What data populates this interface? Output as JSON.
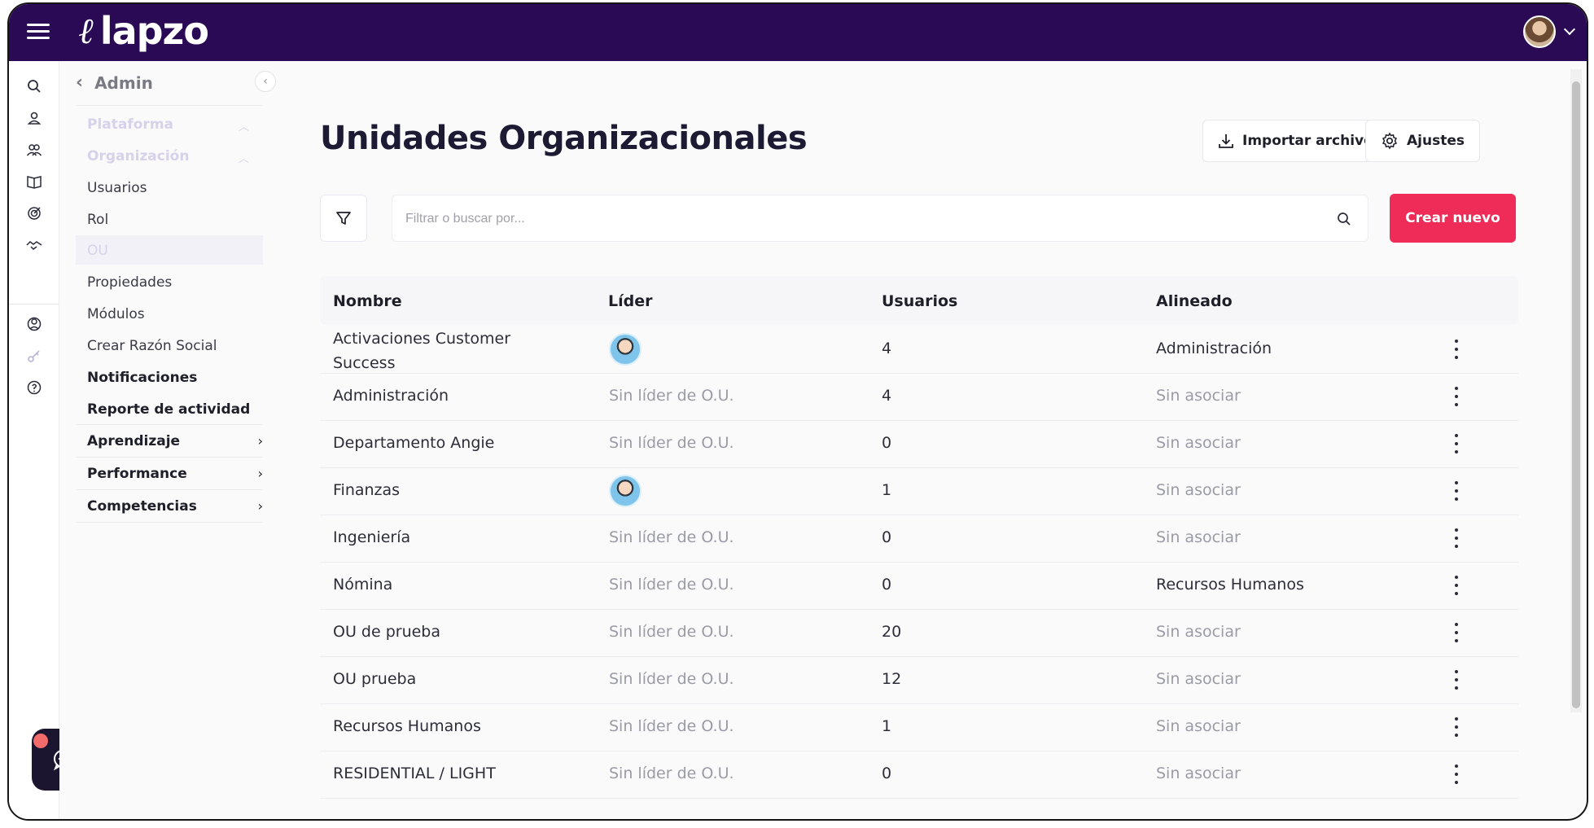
{
  "app": {
    "brand": "lapzo"
  },
  "sidebar": {
    "header": "Admin",
    "items": [
      {
        "label": "Plataforma"
      },
      {
        "label": "Organización"
      },
      {
        "label": "Usuarios"
      },
      {
        "label": "Rol"
      },
      {
        "label": "OU"
      },
      {
        "label": "Propiedades"
      },
      {
        "label": "Módulos"
      },
      {
        "label": "Crear Razón Social"
      },
      {
        "label": "Notificaciones"
      },
      {
        "label": "Reporte de actividad"
      },
      {
        "label": "Aprendizaje"
      },
      {
        "label": "Performance"
      },
      {
        "label": "Competencias"
      }
    ]
  },
  "header": {
    "title": "Unidades Organizacionales",
    "import_label": "Importar archivo",
    "settings_label": "Ajustes"
  },
  "search": {
    "placeholder": "Filtrar o buscar por..."
  },
  "create_label": "Crear nuevo",
  "table": {
    "columns": [
      "Nombre",
      "Líder",
      "Usuarios",
      "Alineado"
    ],
    "rows": [
      {
        "name": "Activaciones Customer Success",
        "leader": "",
        "users": "4",
        "aligned": "Administración"
      },
      {
        "name": "Administración",
        "leader": "Sin líder de O.U.",
        "users": "4",
        "aligned": "Sin asociar"
      },
      {
        "name": "Departamento Angie",
        "leader": "Sin líder de O.U.",
        "users": "0",
        "aligned": "Sin asociar"
      },
      {
        "name": "Finanzas",
        "leader": "",
        "users": "1",
        "aligned": "Sin asociar"
      },
      {
        "name": "Ingeniería",
        "leader": "Sin líder de O.U.",
        "users": "0",
        "aligned": "Sin asociar"
      },
      {
        "name": "Nómina",
        "leader": "Sin líder de O.U.",
        "users": "0",
        "aligned": "Recursos Humanos"
      },
      {
        "name": "OU de prueba",
        "leader": "Sin líder de O.U.",
        "users": "20",
        "aligned": "Sin asociar"
      },
      {
        "name": "OU prueba",
        "leader": "Sin líder de O.U.",
        "users": "12",
        "aligned": "Sin asociar"
      },
      {
        "name": "Recursos Humanos",
        "leader": "Sin líder de O.U.",
        "users": "1",
        "aligned": "Sin asociar"
      },
      {
        "name": "RESIDENTIAL / LIGHT",
        "leader": "Sin líder de O.U.",
        "users": "0",
        "aligned": "Sin asociar"
      }
    ]
  },
  "colors": {
    "topbar": "#2a0a55",
    "primary": "#ef2b57"
  }
}
